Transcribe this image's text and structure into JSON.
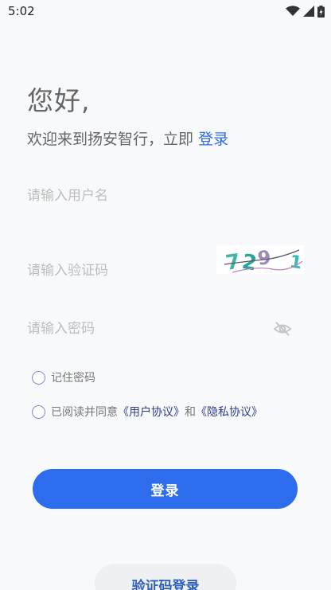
{
  "status_bar": {
    "time": "5:02",
    "icons": [
      "wifi-icon",
      "cellular-icon",
      "battery-icon"
    ]
  },
  "greeting": {
    "title": "您好,",
    "subtitle_prefix": "欢迎来到扬安智行，立即",
    "subtitle_link": "登录"
  },
  "form": {
    "username_placeholder": "请输入用户名",
    "captcha_placeholder": "请输入验证码",
    "password_placeholder": "请输入密码",
    "captcha_text": "7291"
  },
  "options": {
    "remember_label": "记住密码",
    "agree_prefix": "已阅读并同意",
    "user_agreement": "《用户协议》",
    "agree_and": "和",
    "privacy_agreement": "《隐私协议》"
  },
  "actions": {
    "login_label": "登录",
    "sms_login_label": "验证码登录"
  },
  "colors": {
    "accent": "#2d6ded",
    "link": "#2f6be8",
    "background": "#f8f9fb"
  }
}
